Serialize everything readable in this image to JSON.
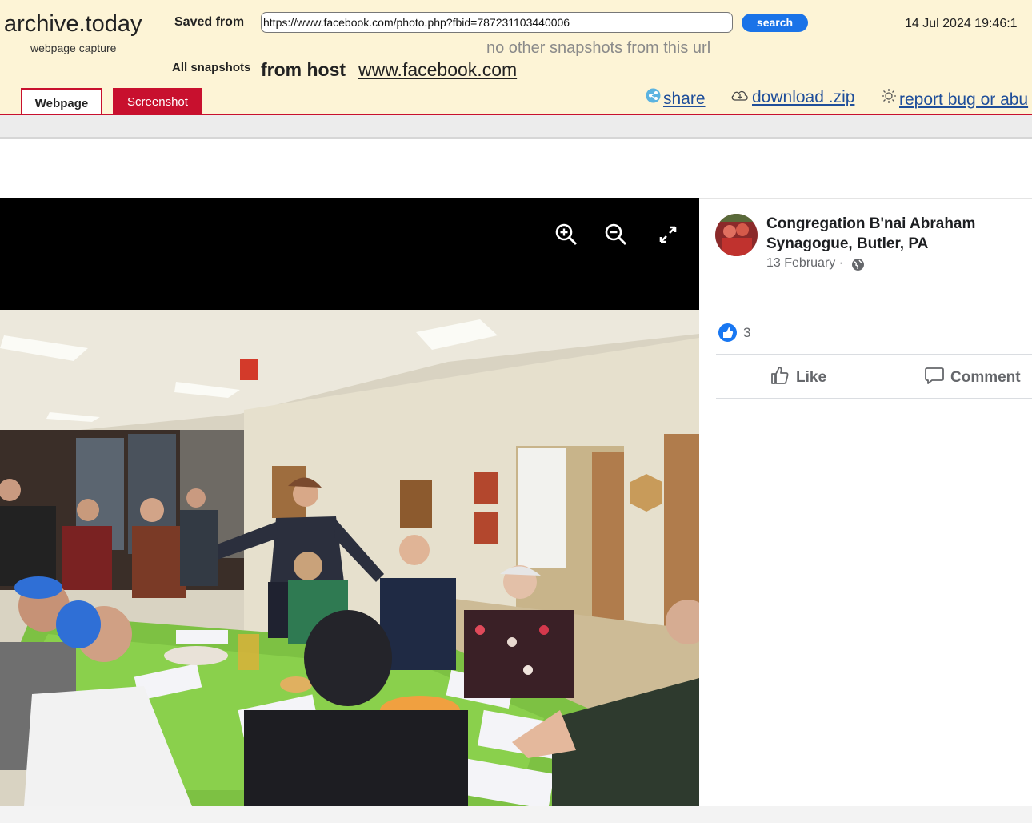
{
  "archive": {
    "logo": "archive.today",
    "logo_sub": "webpage capture",
    "saved_from_label": "Saved from",
    "url": "https://www.facebook.com/photo.php?fbid=787231103440006",
    "search_label": "search",
    "timestamp": "14 Jul 2024 19:46:1",
    "no_snapshots": "no other snapshots from this url",
    "all_snapshots": "All snapshots",
    "from_host": "from host",
    "host": "www.facebook.com",
    "tabs": [
      {
        "label": "Webpage",
        "active": true
      },
      {
        "label": "Screenshot",
        "active": false
      }
    ],
    "links": {
      "share": "share",
      "download": "download .zip",
      "report": "report bug or abu"
    },
    "accent": "#c8102e",
    "bg": "#fdf4d6"
  },
  "post": {
    "page_name": "Congregation B'nai Abraham Synagogue, Butler, PA",
    "date": "13 February",
    "date_sep": "·",
    "audience_icon": "globe-icon",
    "reactions": {
      "icon": "like-reaction-icon",
      "count": "3"
    },
    "actions": {
      "like": "Like",
      "comment": "Comment"
    },
    "accent": "#1877f2"
  },
  "viewer": {
    "controls": [
      "zoom-in-icon",
      "zoom-out-icon",
      "fullscreen-icon"
    ],
    "photo_subject": "people seated around a green-covered table in a room with lights"
  }
}
